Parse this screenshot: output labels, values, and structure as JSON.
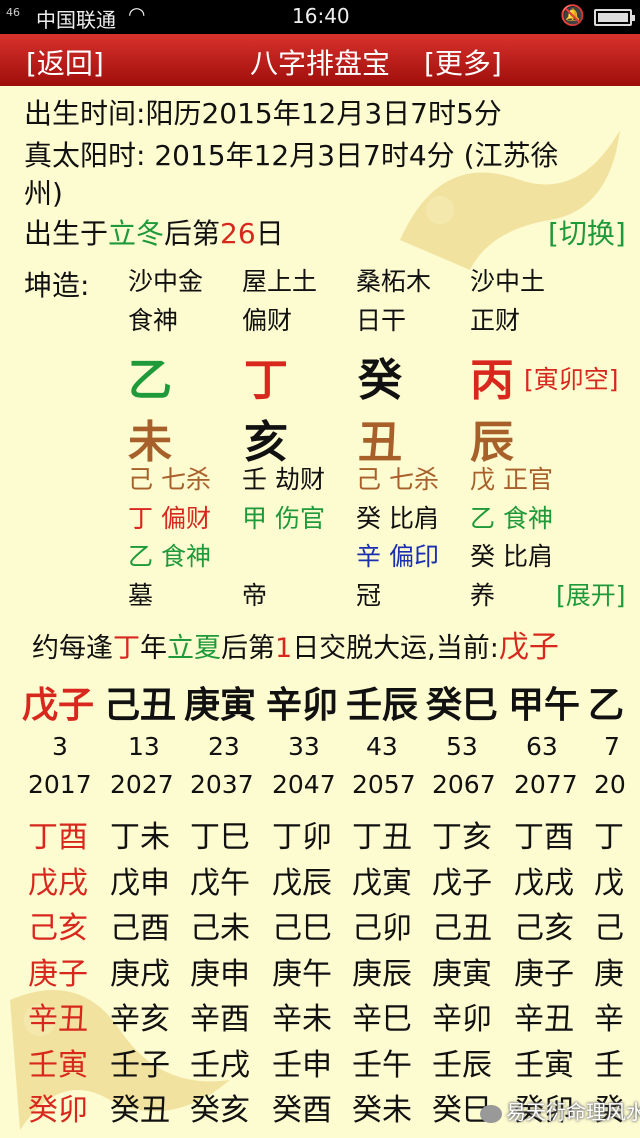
{
  "status_bar": {
    "signal": "46",
    "carrier": "中国联通",
    "time": "16:40"
  },
  "header": {
    "back": "[返回]",
    "title": "八字排盘宝",
    "more": "[更多]"
  },
  "birth": {
    "label": "出生时间:",
    "value": "阳历2015年12月3日7时5分",
    "solar_label": "真太阳时:",
    "solar_value": "2015年12月3日7时4分 (江苏徐",
    "solar_value2": "州)",
    "term_pre": "出生于",
    "term": "立冬",
    "term_mid": "后第",
    "term_day": "26",
    "term_post": "日",
    "switch": "[切换]"
  },
  "chart": {
    "label": "坤造:",
    "nayin": [
      "沙中金",
      "屋上土",
      "桑柘木",
      "沙中土"
    ],
    "gods": [
      "食神",
      "偏财",
      "日干",
      "正财"
    ],
    "stems": [
      "乙",
      "丁",
      "癸",
      "丙"
    ],
    "kongwang": "[寅卯空]",
    "branches": [
      "未",
      "亥",
      "丑",
      "辰"
    ],
    "hidden": [
      [
        "己 七杀",
        "丁 偏财",
        "乙 食神"
      ],
      [
        "壬 劫财",
        "甲 伤官"
      ],
      [
        "己 七杀",
        "癸 比肩",
        "辛 偏印"
      ],
      [
        "戊 正官",
        "乙 食神",
        "癸 比肩"
      ]
    ],
    "stages": [
      "墓",
      "帝",
      "冠",
      "养"
    ],
    "expand": "[展开]"
  },
  "dayun": {
    "pre": "约每逢",
    "stem": "丁",
    "mid1": "年",
    "term": "立夏",
    "mid2": "后第",
    "day": "1",
    "post": "日交脱大运,当前:",
    "current": "戊子",
    "pillars": [
      "戊子",
      "己丑",
      "庚寅",
      "辛卯",
      "壬辰",
      "癸巳",
      "甲午",
      "乙"
    ],
    "ages": [
      "3",
      "13",
      "23",
      "33",
      "43",
      "53",
      "63",
      "7"
    ],
    "years": [
      "2017",
      "2027",
      "2037",
      "2047",
      "2057",
      "2067",
      "2077",
      "20"
    ]
  },
  "liunian": [
    [
      "丁酉",
      "丁未",
      "丁巳",
      "丁卯",
      "丁丑",
      "丁亥",
      "丁酉",
      "丁"
    ],
    [
      "戊戌",
      "戊申",
      "戊午",
      "戊辰",
      "戊寅",
      "戊子",
      "戊戌",
      "戊"
    ],
    [
      "己亥",
      "己酉",
      "己未",
      "己巳",
      "己卯",
      "己丑",
      "己亥",
      "己"
    ],
    [
      "庚子",
      "庚戌",
      "庚申",
      "庚午",
      "庚辰",
      "庚寅",
      "庚子",
      "庚"
    ],
    [
      "辛丑",
      "辛亥",
      "辛酉",
      "辛未",
      "辛巳",
      "辛卯",
      "辛丑",
      "辛"
    ],
    [
      "壬寅",
      "壬子",
      "壬戌",
      "壬申",
      "壬午",
      "壬辰",
      "壬寅",
      "壬"
    ],
    [
      "癸卯",
      "癸丑",
      "癸亥",
      "癸酉",
      "癸未",
      "癸巳",
      "癸卯",
      "癸"
    ]
  ],
  "watermark": "易天衍命理风水"
}
